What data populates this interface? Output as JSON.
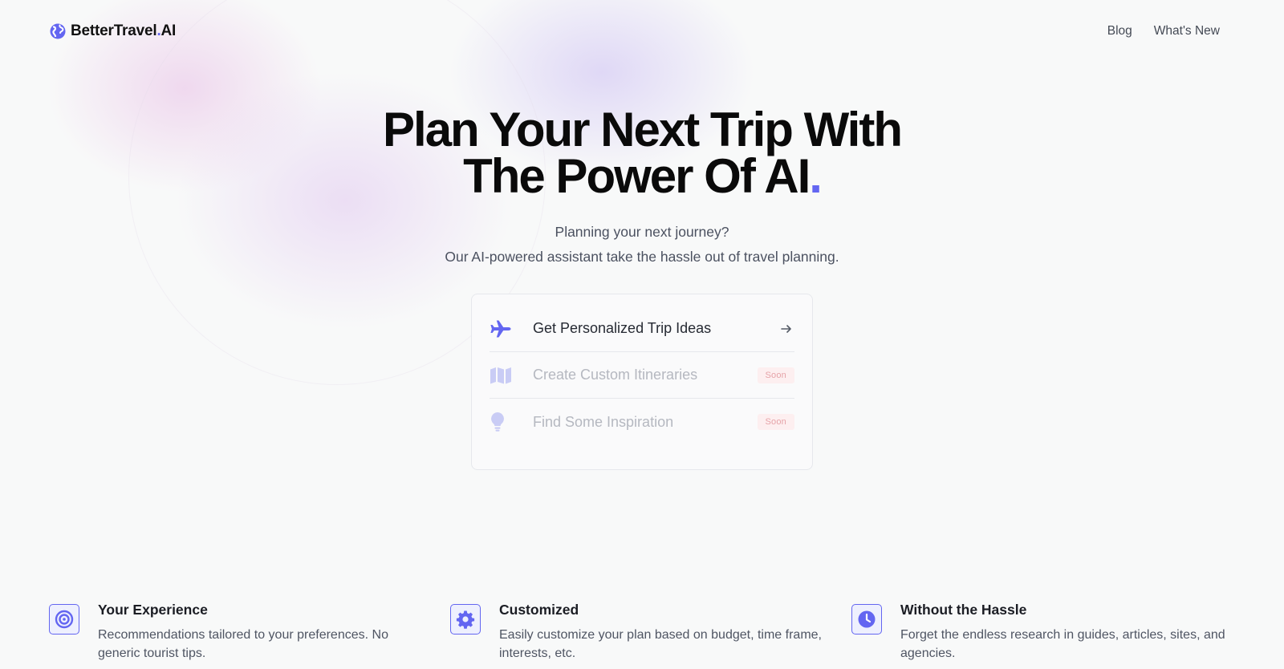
{
  "brand": {
    "name": "BetterTravel",
    "dot": ".",
    "suffix": "AI",
    "accent": "#6366f1"
  },
  "nav": {
    "items": [
      {
        "label": "Blog"
      },
      {
        "label": "What's New"
      }
    ]
  },
  "hero": {
    "title_line1": "Plan Your Next Trip With",
    "title_line2": "The Power Of AI",
    "title_dot": ".",
    "subtitle1": "Planning your next journey?",
    "subtitle2": "Our AI-powered assistant take the hassle out of travel planning."
  },
  "options": [
    {
      "label": "Get Personalized Trip Ideas",
      "icon": "airplane-icon",
      "status": "available"
    },
    {
      "label": "Create Custom Itineraries",
      "icon": "map-icon",
      "badge": "Soon",
      "status": "disabled"
    },
    {
      "label": "Find Some Inspiration",
      "icon": "lightbulb-icon",
      "badge": "Soon",
      "status": "disabled"
    }
  ],
  "features": [
    {
      "title": "Your Experience",
      "description": "Recommendations tailored to your preferences. No generic tourist tips.",
      "icon": "target-icon"
    },
    {
      "title": "Customized",
      "description": "Easily customize your plan based on budget, time frame, interests, etc.",
      "icon": "gear-icon"
    },
    {
      "title": "Without the Hassle",
      "description": "Forget the endless research in guides, articles, sites, and agencies.",
      "icon": "clock-icon"
    }
  ],
  "colors": {
    "accent": "#6366f1",
    "background": "#f8f9f9",
    "soon_badge": "#fdeff0"
  }
}
